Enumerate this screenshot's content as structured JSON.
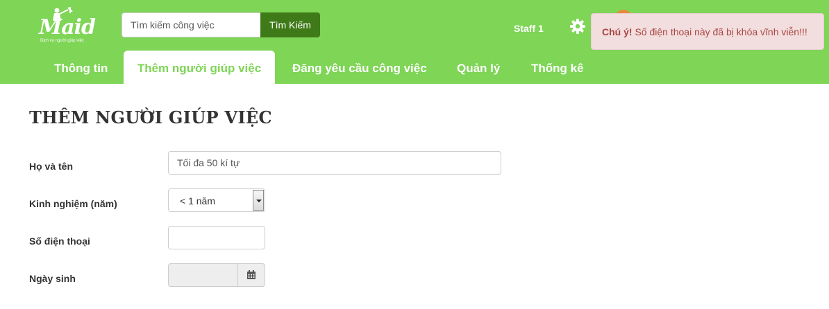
{
  "brand": {
    "logo_text": "Maid",
    "tagline": "Dịch vụ người giúp việc"
  },
  "search": {
    "placeholder": "Tìm kiếm công việc",
    "button_label": "Tìm Kiếm"
  },
  "user": {
    "name": "Staff 1"
  },
  "icons": {
    "settings": "gear-icon",
    "calendar": "calendar-icon"
  },
  "nav": {
    "tabs": [
      {
        "label": "Thông tin"
      },
      {
        "label": "Thêm người giúp việc",
        "active": true
      },
      {
        "label": "Đăng yêu cầu công việc"
      },
      {
        "label": "Quản lý"
      },
      {
        "label": "Thống kê"
      }
    ]
  },
  "alert": {
    "strong": "Chú ý!",
    "message": " Số điện thoại này đã bị khóa vĩnh viễn!!!"
  },
  "form": {
    "title": "THÊM NGƯỜI GIÚP VIỆC",
    "full_name": {
      "label": "Họ và tên",
      "placeholder": "Tối đa 50 kí tự"
    },
    "experience": {
      "label": "Kinh nghiệm (năm)",
      "value": "< 1 năm"
    },
    "phone": {
      "label": "Số điện thoại",
      "value": ""
    },
    "birthdate": {
      "label": "Ngày sinh",
      "value": ""
    }
  },
  "colors": {
    "header_green": "#7ed556",
    "search_button": "#3f7a18",
    "alert_bg": "#f2dede",
    "alert_text": "#a94442"
  }
}
